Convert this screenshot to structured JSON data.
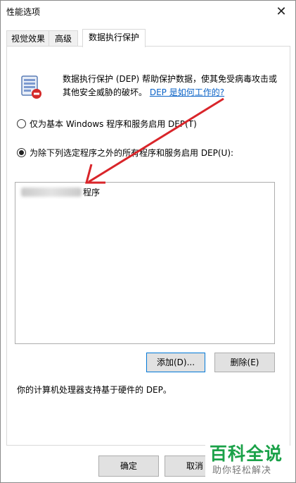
{
  "window": {
    "title": "性能选项",
    "close_glyph": "✕"
  },
  "tabs": [
    {
      "label": "视觉效果",
      "active": false
    },
    {
      "label": "高级",
      "active": false
    },
    {
      "label": "数据执行保护",
      "active": true
    }
  ],
  "dep": {
    "icon": "dep-shield-icon",
    "description": "数据执行保护 (DEP) 帮助保护数据，使其免受病毒攻击或其他安全威胁的破坏。",
    "help_link": "DEP 是如何工作的?"
  },
  "options": {
    "basic_label": "仅为基本 Windows 程序和服务启用 DEP(T)",
    "basic_selected": false,
    "all_except_label": "为除下列选定程序之外的所有程序和服务启用 DEP(U):",
    "all_except_selected": true
  },
  "program_list": {
    "items": [
      {
        "suffix": "程序"
      }
    ]
  },
  "buttons": {
    "add": "添加(D)...",
    "remove": "删除(E)",
    "ok": "确定",
    "cancel": "取消"
  },
  "hardware_note": "你的计算机处理器支持基于硬件的 DEP。",
  "watermark": {
    "main": "百科全说",
    "sub": "助你轻松解决"
  },
  "colors": {
    "link": "#0b63c7",
    "annotation_arrow": "#d9252a",
    "watermark_green": "#1aa148",
    "focus_border": "#0078d7"
  }
}
